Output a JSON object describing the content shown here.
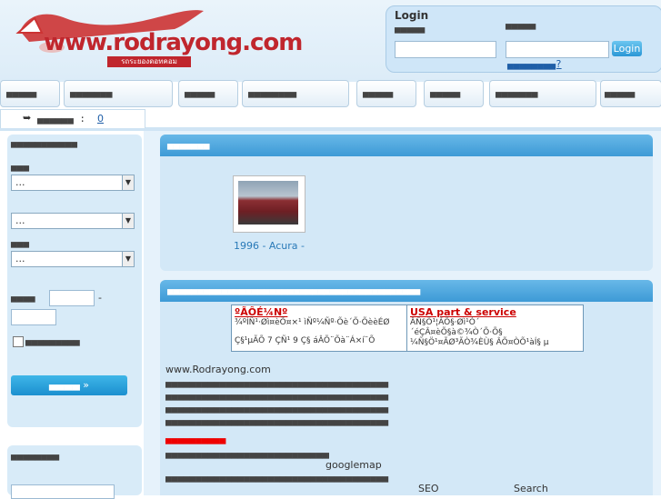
{
  "header": {
    "logo_text": "www.rodrayong.com",
    "logo_sub": "รถระยองดอทคอม",
    "login_title": "Login",
    "login_label_user": "▄▄▄▄▄",
    "login_label_pass": "▄▄▄▄▄",
    "login_button": "Login",
    "forgot_link": "▄▄▄▄▄▄▄▄?"
  },
  "nav": {
    "items": [
      {
        "label": "▄▄▄▄▄"
      },
      {
        "label": "▄▄▄▄▄▄▄"
      },
      {
        "label": "▄▄▄▄▄"
      },
      {
        "label": "▄▄▄▄▄▄▄▄"
      },
      {
        "label": "▄▄▄▄▄"
      },
      {
        "label": "▄▄▄▄▄"
      },
      {
        "label": "▄▄▄▄▄▄▄"
      },
      {
        "label": "▄▄▄▄▄"
      }
    ]
  },
  "left": {
    "tab_label": "▄▄▄▄▄▄ :",
    "tab_count": "0",
    "panel_title": "▄▄▄▄▄▄▄▄▄▄▄",
    "label1": "▄▄▄",
    "select1": "...",
    "select2": "...",
    "label3": "▄▄▄",
    "select3": "...",
    "price_label": "▄▄▄▄",
    "price_sep": "-",
    "checkbox_label": "▄▄▄▄▄▄▄▄▄",
    "search_button": "▄▄▄▄ »",
    "panel2_title": "▄▄▄▄▄▄▄▄"
  },
  "main": {
    "box1_title": "▄▄▄▄▄▄▄",
    "car_caption": "1996 - Acura -",
    "box2_title": "▄▄▄▄▄▄▄▄▄▄▄▄▄▄▄▄▄▄▄▄▄▄▄▄▄▄▄▄▄▄▄▄▄▄▄▄▄▄▄▄▄▄",
    "ad_left_title": "ºÃÔÉ¼Nº",
    "ad_left_text1": "¾ºÍÑ¹·Øì¤èÕ¤×¹ ìÑº¼Ñº·Õè´Õ·ÕèèÉØ",
    "ad_left_text2": "Ç§¹µÃÕ 7 ÇÑ¹ 9 Ç§ áÂÕ¨Õà¨Á×í¨Õ",
    "ad_right_title": "USA part & service",
    "ad_right_text1": "ÂÑ§Ö¹¦ÃÕ§·Øì¹Ó´",
    "ad_right_text2": "´éÇÂ¤èÕ§à©¾Ò´Õ·Õ§",
    "ad_right_text3": "¼Ñ§Ö¹¤ÃØ³ÃÒ¾ÈÙ§ ÂÕ¤ÒÕ¹àÍ§ µ",
    "body_intro": "www.Rodrayong.com",
    "body_line": "▄▄▄▄▄▄▄▄▄▄▄▄▄▄▄▄▄▄▄▄▄▄▄▄▄▄▄▄▄▄▄▄▄▄▄▄▄",
    "red_line": "▄▄▄▄▄▄▄▄▄▄",
    "googlemap_text": "googlemap",
    "seo_text": "SEO",
    "search_text": "Search"
  }
}
